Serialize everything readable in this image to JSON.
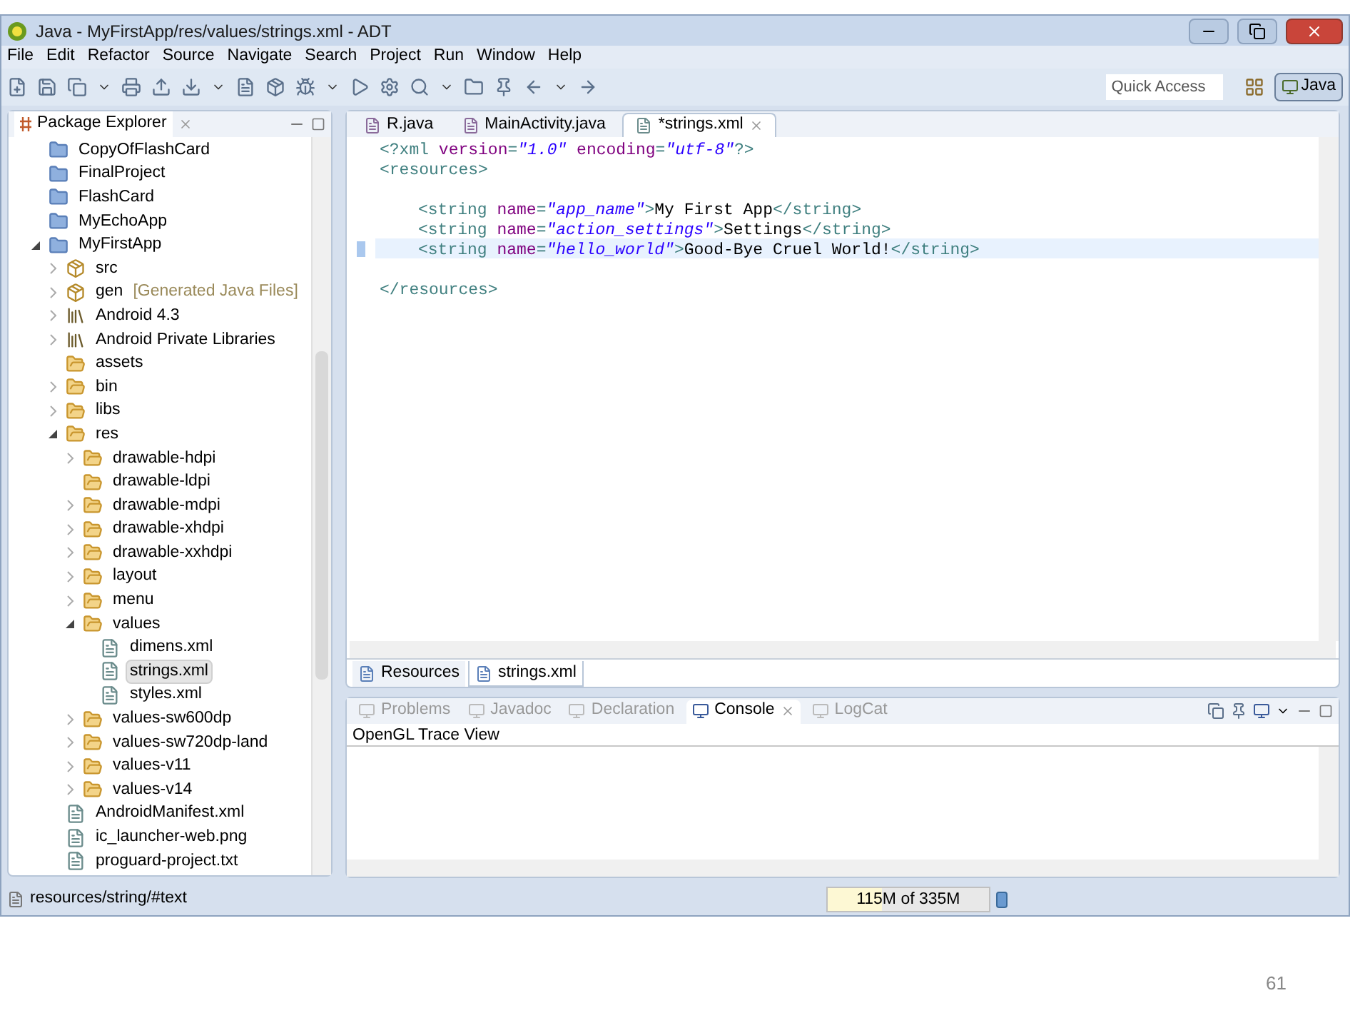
{
  "window": {
    "title": "Java - MyFirstApp/res/values/strings.xml - ADT"
  },
  "menu": [
    "File",
    "Edit",
    "Refactor",
    "Source",
    "Navigate",
    "Search",
    "Project",
    "Run",
    "Window",
    "Help"
  ],
  "quick_access": {
    "placeholder": "Quick Access"
  },
  "perspective": {
    "label": "Java",
    "selected": true
  },
  "package_explorer": {
    "title": "Package Explorer",
    "tree": [
      {
        "label": "CopyOfFlashCard",
        "kind": "project"
      },
      {
        "label": "FinalProject",
        "kind": "project"
      },
      {
        "label": "FlashCard",
        "kind": "project"
      },
      {
        "label": "MyEchoApp",
        "kind": "project"
      },
      {
        "label": "MyFirstApp",
        "kind": "project",
        "expanded": true,
        "children": [
          {
            "label": "src",
            "kind": "source",
            "expanded": false
          },
          {
            "label": "gen",
            "note": "[Generated Java Files]",
            "kind": "source",
            "expanded": false
          },
          {
            "label": "Android 4.3",
            "kind": "library",
            "expanded": false
          },
          {
            "label": "Android Private Libraries",
            "kind": "library",
            "expanded": false
          },
          {
            "label": "assets",
            "kind": "folder"
          },
          {
            "label": "bin",
            "kind": "folder",
            "expanded": false
          },
          {
            "label": "libs",
            "kind": "folder",
            "expanded": false
          },
          {
            "label": "res",
            "kind": "folder",
            "expanded": true,
            "children": [
              {
                "label": "drawable-hdpi",
                "kind": "folder",
                "expanded": false
              },
              {
                "label": "drawable-ldpi",
                "kind": "folder"
              },
              {
                "label": "drawable-mdpi",
                "kind": "folder",
                "expanded": false
              },
              {
                "label": "drawable-xhdpi",
                "kind": "folder",
                "expanded": false
              },
              {
                "label": "drawable-xxhdpi",
                "kind": "folder",
                "expanded": false
              },
              {
                "label": "layout",
                "kind": "folder",
                "expanded": false
              },
              {
                "label": "menu",
                "kind": "folder",
                "expanded": false
              },
              {
                "label": "values",
                "kind": "folder",
                "expanded": true,
                "children": [
                  {
                    "label": "dimens.xml",
                    "kind": "file",
                    "selected": false
                  },
                  {
                    "label": "strings.xml",
                    "kind": "file",
                    "selected": true
                  },
                  {
                    "label": "styles.xml",
                    "kind": "file",
                    "selected": false
                  }
                ]
              },
              {
                "label": "values-sw600dp",
                "kind": "folder",
                "expanded": false
              },
              {
                "label": "values-sw720dp-land",
                "kind": "folder",
                "expanded": false
              },
              {
                "label": "values-v11",
                "kind": "folder",
                "expanded": false
              },
              {
                "label": "values-v14",
                "kind": "folder",
                "expanded": false
              }
            ]
          },
          {
            "label": "AndroidManifest.xml",
            "kind": "file"
          },
          {
            "label": "ic_launcher-web.png",
            "kind": "file"
          },
          {
            "label": "proguard-project.txt",
            "kind": "file"
          }
        ]
      }
    ]
  },
  "editor": {
    "tabs": [
      {
        "label": "R.java",
        "selected": false,
        "kind": "java"
      },
      {
        "label": "MainActivity.java",
        "selected": false,
        "kind": "java"
      },
      {
        "label": "*strings.xml",
        "selected": true,
        "kind": "xml"
      }
    ],
    "lines": [
      {
        "current": false,
        "tokens": [
          {
            "kind": "tag",
            "text": "<?xml "
          },
          {
            "kind": "attr",
            "text": "version"
          },
          {
            "kind": "tag",
            "text": "="
          },
          {
            "kind": "value",
            "text": "\"1.0\""
          },
          {
            "kind": "attr",
            "text": " encoding"
          },
          {
            "kind": "tag",
            "text": "="
          },
          {
            "kind": "value",
            "text": "\"utf-8\""
          },
          {
            "kind": "tag",
            "text": "?>"
          }
        ]
      },
      {
        "current": false,
        "tokens": [
          {
            "kind": "tag",
            "text": "<resources>"
          }
        ]
      },
      {
        "current": false,
        "blank_before": true,
        "indent": true,
        "tokens": [
          {
            "kind": "tag",
            "text": "<string "
          },
          {
            "kind": "attr",
            "text": "name"
          },
          {
            "kind": "tag",
            "text": "="
          },
          {
            "kind": "value",
            "text": "\"app_name\""
          },
          {
            "kind": "tag",
            "text": ">"
          },
          {
            "kind": "text",
            "text": "My First App"
          },
          {
            "kind": "tag",
            "text": "</string>"
          }
        ]
      },
      {
        "current": false,
        "indent": true,
        "tokens": [
          {
            "kind": "tag",
            "text": "<string "
          },
          {
            "kind": "attr",
            "text": "name"
          },
          {
            "kind": "tag",
            "text": "="
          },
          {
            "kind": "value",
            "text": "\"action_settings\""
          },
          {
            "kind": "tag",
            "text": ">"
          },
          {
            "kind": "text",
            "text": "Settings"
          },
          {
            "kind": "tag",
            "text": "</string>"
          }
        ]
      },
      {
        "current": true,
        "indent": true,
        "tokens": [
          {
            "kind": "tag",
            "text": "<string "
          },
          {
            "kind": "attr",
            "text": "name"
          },
          {
            "kind": "tag",
            "text": "="
          },
          {
            "kind": "value",
            "text": "\"hello_world\""
          },
          {
            "kind": "tag",
            "text": ">"
          },
          {
            "kind": "text",
            "text": "Good-Bye Cruel World!"
          },
          {
            "kind": "tag",
            "text": "</string>"
          }
        ]
      },
      {
        "current": false,
        "blank_before": true,
        "tokens": [
          {
            "kind": "tag",
            "text": "</resources>"
          }
        ]
      }
    ],
    "bottom_tabs": [
      {
        "label": "Resources",
        "selected": false
      },
      {
        "label": "strings.xml",
        "selected": true
      }
    ]
  },
  "console": {
    "tabs": [
      {
        "label": "Problems",
        "selected": false
      },
      {
        "label": "Javadoc",
        "selected": false
      },
      {
        "label": "Declaration",
        "selected": false
      },
      {
        "label": "Console",
        "selected": true
      },
      {
        "label": "LogCat",
        "selected": false
      }
    ],
    "header": "OpenGL Trace View"
  },
  "status_bar": {
    "path": "resources/string/#text",
    "memory": {
      "reading": "115M of 335M",
      "level": 0.34
    }
  },
  "slide_number": "61"
}
